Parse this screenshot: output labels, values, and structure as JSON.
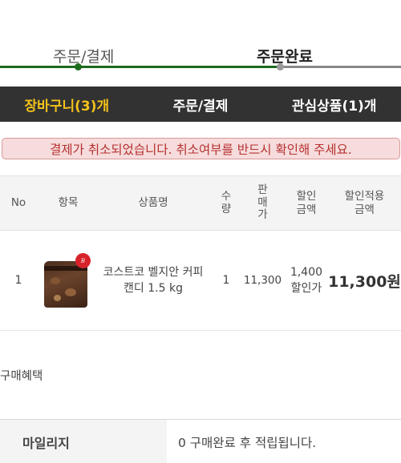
{
  "progress": {
    "steps": [
      {
        "label": "주문/결제"
      },
      {
        "label": "주문완료"
      }
    ],
    "colors": {
      "done": "#1d6b1d",
      "pending": "#888888"
    }
  },
  "tabs": [
    {
      "label": "장바구니(3)개",
      "active": true
    },
    {
      "label": "주문/결제",
      "active": false
    },
    {
      "label": "관심상품(1)개",
      "active": false
    }
  ],
  "alert": {
    "message": "결제가 취소되었습니다. 취소여부를 반드시 확인해 주세요."
  },
  "table": {
    "headers": {
      "no": "No",
      "item": "항목",
      "name": "상품명",
      "qty": "수량",
      "price": "판매가",
      "discount": "할인 금액",
      "final": "할인적용 금액"
    },
    "rows": [
      {
        "no": "1",
        "image_icon": "coffee-candy-bag-icon",
        "name": "코스트코 벨지안 커피 캔디 1.5 kg",
        "qty": "1",
        "price": "11,300",
        "discount": "1,400",
        "discount_suffix": "할인가",
        "final": "11,300원"
      }
    ]
  },
  "benefits": {
    "title": "구매혜택"
  },
  "mileage": {
    "label": "마일리지",
    "text": "0 구매완료 후 적립됩니다."
  },
  "theme": {
    "accent": "#f3c21a",
    "tab_bg": "#323232",
    "alert_bg": "#f6dcdc",
    "alert_text": "#b73030"
  }
}
